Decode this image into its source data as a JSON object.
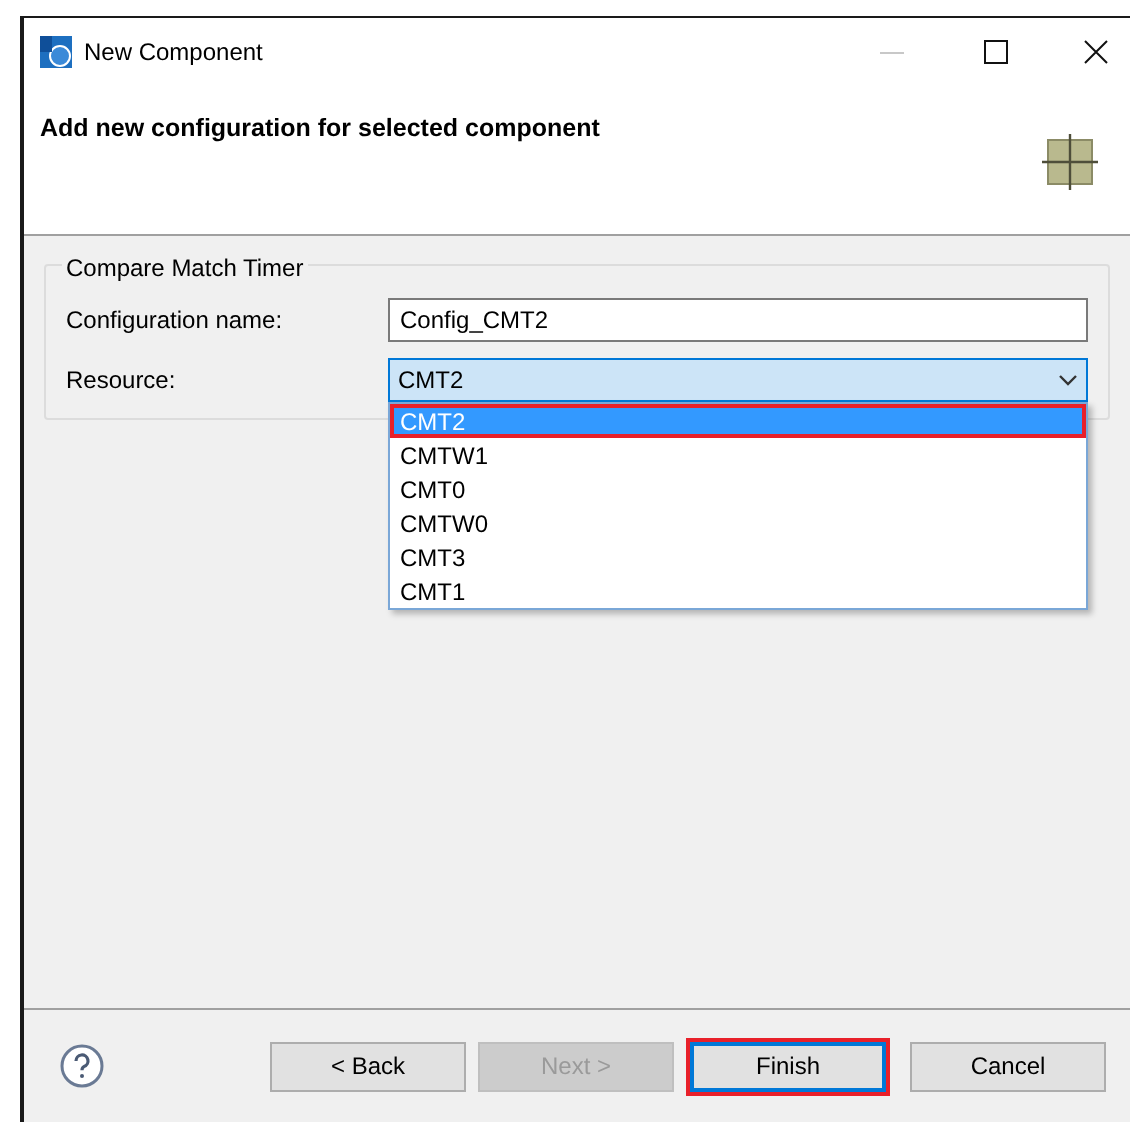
{
  "window": {
    "title": "New Component"
  },
  "header": {
    "title": "Add new configuration for selected component"
  },
  "group": {
    "title": "Compare Match Timer",
    "fields": [
      {
        "kind": "text",
        "label": "Configuration name:",
        "value": "Config_CMT2"
      },
      {
        "kind": "combo",
        "label": "Resource:",
        "value": "CMT2",
        "expanded": true,
        "options": [
          {
            "label": "CMT2",
            "selected": true,
            "annotated": true
          },
          {
            "label": "CMTW1",
            "selected": false,
            "annotated": false
          },
          {
            "label": "CMT0",
            "selected": false,
            "annotated": false
          },
          {
            "label": "CMTW0",
            "selected": false,
            "annotated": false
          },
          {
            "label": "CMT3",
            "selected": false,
            "annotated": false
          },
          {
            "label": "CMT1",
            "selected": false,
            "annotated": false
          }
        ]
      }
    ]
  },
  "buttons": [
    {
      "label": "< Back",
      "disabled": false,
      "default": false,
      "annotated": false
    },
    {
      "label": "Next >",
      "disabled": true,
      "default": false,
      "annotated": false
    },
    {
      "label": "Finish",
      "disabled": false,
      "default": true,
      "annotated": true
    },
    {
      "label": "Cancel",
      "disabled": false,
      "default": false,
      "annotated": false
    }
  ]
}
